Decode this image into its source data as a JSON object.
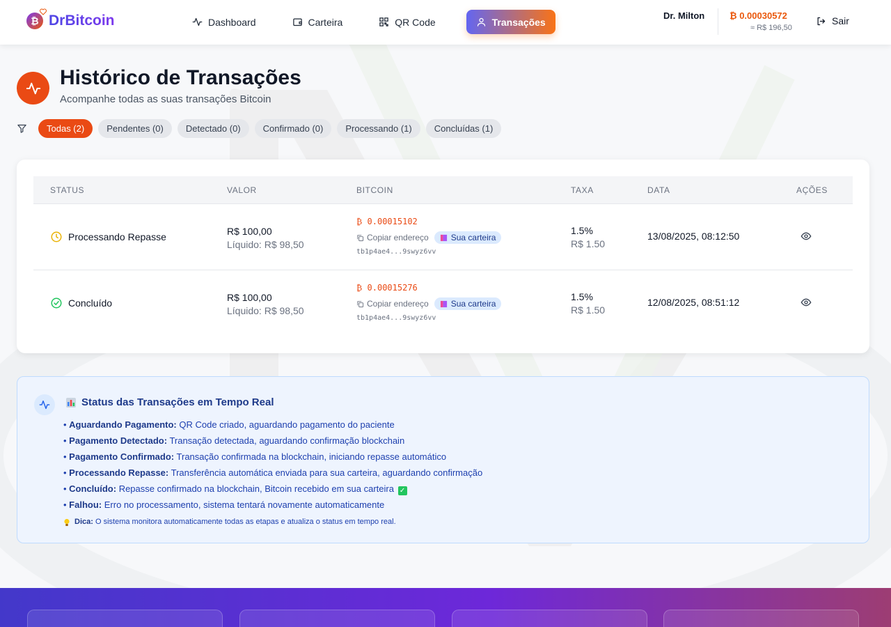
{
  "app": {
    "name": "DrBitcoin",
    "logo_glyph": "₿"
  },
  "nav": {
    "items": [
      {
        "label": "Dashboard",
        "icon": "activity-icon"
      },
      {
        "label": "Carteira",
        "icon": "wallet-icon"
      },
      {
        "label": "QR Code",
        "icon": "qr-code-icon"
      },
      {
        "label": "Transações",
        "icon": "user-icon",
        "active": true
      }
    ]
  },
  "user": {
    "name": "Dr. Milton",
    "balance_btc": "₿ 0.00030572",
    "balance_brl": "≈ R$ 196,50",
    "logout_label": "Sair"
  },
  "page": {
    "title": "Histórico de Transações",
    "subtitle": "Acompanhe todas as suas transações Bitcoin"
  },
  "filters": [
    {
      "label": "Todas (2)",
      "active": true
    },
    {
      "label": "Pendentes (0)"
    },
    {
      "label": "Detectado (0)"
    },
    {
      "label": "Confirmado (0)"
    },
    {
      "label": "Processando (1)"
    },
    {
      "label": "Concluídas (1)"
    }
  ],
  "table": {
    "headers": [
      "STATUS",
      "VALOR",
      "BITCOIN",
      "TAXA",
      "DATA",
      "AÇÕES"
    ],
    "rows": [
      {
        "status": "Processando Repasse",
        "status_icon": "clock-icon",
        "valor": "R$ 100,00",
        "liquido": "Líquido: R$ 98,50",
        "btc_amount": "₿ 0.00015102",
        "copy_label": "Copiar endereço",
        "wallet_label": "Sua carteira",
        "address": "tb1p4ae4...9swyz6vv",
        "taxa_pct": "1.5%",
        "taxa_valor": "R$ 1.50",
        "data": "13/08/2025, 08:12:50"
      },
      {
        "status": "Concluído",
        "status_icon": "check-circle-icon",
        "valor": "R$ 100,00",
        "liquido": "Líquido: R$ 98,50",
        "btc_amount": "₿ 0.00015276",
        "copy_label": "Copiar endereço",
        "wallet_label": "Sua carteira",
        "address": "tb1p4ae4...9swyz6vv",
        "taxa_pct": "1.5%",
        "taxa_valor": "R$ 1.50",
        "data": "12/08/2025, 08:51:12"
      }
    ]
  },
  "info": {
    "title": "Status das Transações em Tempo Real",
    "items": [
      {
        "label": "Aguardando Pagamento:",
        "text": "QR Code criado, aguardando pagamento do paciente"
      },
      {
        "label": "Pagamento Detectado:",
        "text": "Transação detectada, aguardando confirmação blockchain"
      },
      {
        "label": "Pagamento Confirmado:",
        "text": "Transação confirmada na blockchain, iniciando repasse automático"
      },
      {
        "label": "Processando Repasse:",
        "text": "Transferência automática enviada para sua carteira, aguardando confirmação"
      },
      {
        "label": "Concluído:",
        "text": "Repasse confirmado na blockchain, Bitcoin recebido em sua carteira"
      },
      {
        "label": "Falhou:",
        "text": "Erro no processamento, sistema tentará novamente automaticamente"
      }
    ],
    "tip_label": "Dica:",
    "tip_text": "O sistema monitora automaticamente todas as etapas e atualiza o status em tempo real."
  },
  "colors": {
    "accent": "#ea4a14",
    "brand_purple": "#6366f1",
    "info_bg": "#eef4fe",
    "info_text": "#1e40af"
  }
}
